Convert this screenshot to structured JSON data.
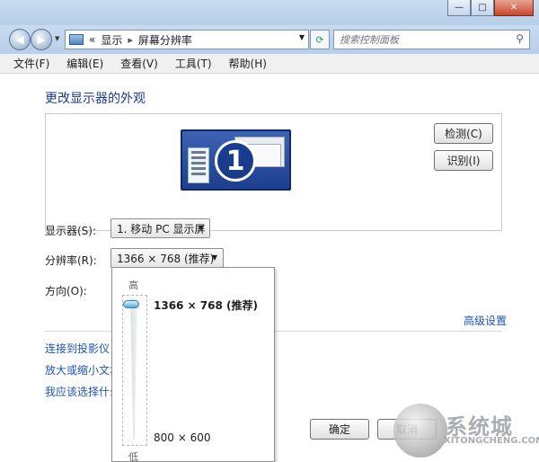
{
  "window": {
    "controls": [
      "—",
      "□",
      "✕"
    ]
  },
  "navigation": {
    "back": "◀",
    "forward": "▶",
    "address_prefix": "«",
    "breadcrumb": [
      "显示",
      "屏幕分辨率"
    ],
    "search_placeholder": "搜索控制面板"
  },
  "menu": [
    "文件(F)",
    "编辑(E)",
    "查看(V)",
    "工具(T)",
    "帮助(H)"
  ],
  "page_title": "更改显示器的外观",
  "monitor": {
    "number": "1"
  },
  "buttons": {
    "detect": "检测(C)",
    "identify": "识别(I)",
    "ok": "确定",
    "cancel": "取消"
  },
  "display": {
    "label": "显示器(S):",
    "value": "1. 移动 PC 显示屏"
  },
  "resolution": {
    "label": "分辨率(R):",
    "value": "1366 × 768 (推荐)"
  },
  "orientation": {
    "label": "方向(O):"
  },
  "advanced_link": "高级设置",
  "links": [
    "连接到投影仪 (",
    "放大或缩小文本",
    "我应该选择什么"
  ],
  "slider_popup": {
    "high_label": "高",
    "low_label": "低",
    "max_option": "1366 × 768 (推荐)",
    "min_option": "800 × 600",
    "level": 1.0
  },
  "watermark": {
    "main": "系统城",
    "sub": "XITONGCHENG.COM"
  }
}
